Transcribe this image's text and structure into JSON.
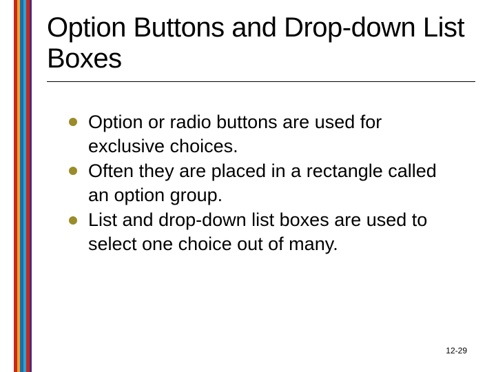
{
  "accent_colors": [
    "#c52a1d",
    "#f4a028",
    "#1f6da8",
    "#2aa4d6",
    "#c52a1d",
    "#4b2a7a"
  ],
  "title": "Option Buttons and Drop-down List Boxes",
  "bullets": [
    "Option or radio buttons are used for exclusive choices.",
    "Often they are placed in a rectangle called an option group.",
    "List and drop-down list boxes are used to select one choice out of many."
  ],
  "footer": "12-29"
}
